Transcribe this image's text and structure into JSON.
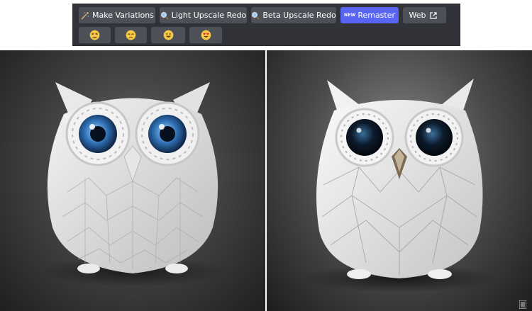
{
  "toolbar": {
    "row1": [
      {
        "label": "Make Variations",
        "icon": "magic-wand-icon"
      },
      {
        "label": "Light Upscale Redo",
        "icon": "magnifier-icon"
      },
      {
        "label": "Beta Upscale Redo",
        "icon": "magnifier-icon"
      },
      {
        "label": "Remaster",
        "badge": "NEW"
      },
      {
        "label": "Web",
        "icon": "external-link-icon"
      }
    ],
    "row2": [
      {
        "icon": "persevering-face-emoji"
      },
      {
        "icon": "unamused-face-emoji"
      },
      {
        "icon": "smiling-face-emoji"
      },
      {
        "icon": "heart-eyes-emoji"
      }
    ]
  },
  "colors": {
    "toolbar_bg": "#313338",
    "button_bg": "#4e5058",
    "primary_button_bg": "#5865f2"
  },
  "images": [
    {
      "subject": "white geometric papercraft owl with blue eyes"
    },
    {
      "subject": "white geometric papercraft owl with dark eyes"
    }
  ]
}
